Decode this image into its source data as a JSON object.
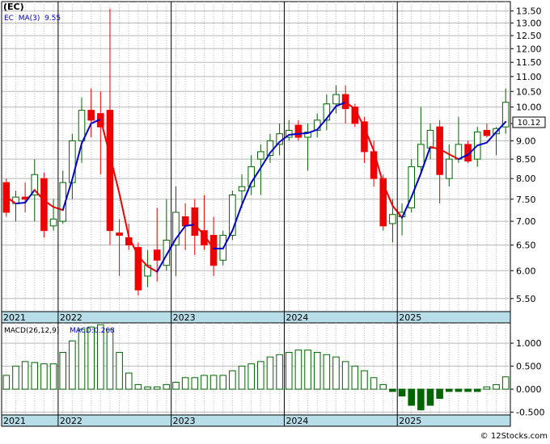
{
  "header": {
    "symbol": "(EC)",
    "ma_label": "EC  MA(3)  9.55",
    "macd_label": "MACD(26,12,9)",
    "macd_value_label": "MACD:0.268",
    "last_price_tag": "10.12",
    "watermark": "© 12Stocks.com"
  },
  "colors": {
    "up_candle": "#006400",
    "down_candle": "#ee0000",
    "ma_up": "#0000cc",
    "ma_down": "#ee0000",
    "macd_bar": "#006400",
    "axis_band": "#b7dde8",
    "grid": "#b8b8b8"
  },
  "chart_data": [
    {
      "type": "candlestick",
      "name": "price",
      "y_tick_labels": [
        "5.50",
        "6.00",
        "6.50",
        "7.00",
        "7.50",
        "8.00",
        "8.50",
        "9.00",
        "9.50",
        "10.00",
        "10.50",
        "11.00",
        "11.50",
        "12.00",
        "12.50",
        "13.00",
        "13.50"
      ],
      "y_scale": "log",
      "ylim": [
        5.28,
        13.9
      ],
      "x_labels": [
        {
          "label": "2021",
          "index": 0
        },
        {
          "label": "2022",
          "index": 6
        },
        {
          "label": "2023",
          "index": 18
        },
        {
          "label": "2024",
          "index": 30
        },
        {
          "label": "2025",
          "index": 42
        }
      ],
      "ohlc": [
        [
          7.9,
          8.0,
          7.1,
          7.2
        ],
        [
          7.4,
          7.7,
          7.0,
          7.55
        ],
        [
          7.55,
          7.9,
          7.2,
          7.5
        ],
        [
          7.6,
          8.5,
          7.0,
          8.1
        ],
        [
          8.0,
          8.15,
          6.65,
          6.8
        ],
        [
          6.9,
          7.5,
          6.8,
          7.05
        ],
        [
          7.0,
          8.2,
          6.95,
          7.9
        ],
        [
          7.9,
          9.2,
          7.5,
          9.0
        ],
        [
          9.0,
          10.3,
          8.4,
          9.9
        ],
        [
          9.9,
          10.6,
          9.1,
          9.6
        ],
        [
          9.8,
          10.5,
          8.1,
          9.4
        ],
        [
          9.9,
          13.6,
          6.5,
          6.8
        ],
        [
          6.75,
          7.05,
          5.9,
          6.7
        ],
        [
          6.65,
          6.95,
          6.4,
          6.5
        ],
        [
          6.45,
          6.55,
          5.55,
          5.65
        ],
        [
          5.9,
          6.4,
          5.7,
          6.1
        ],
        [
          6.4,
          7.3,
          5.8,
          6.2
        ],
        [
          6.1,
          7.5,
          6.0,
          6.6
        ],
        [
          6.5,
          7.8,
          5.9,
          7.2
        ],
        [
          7.1,
          7.4,
          6.4,
          6.9
        ],
        [
          7.3,
          7.5,
          6.3,
          6.7
        ],
        [
          6.8,
          7.6,
          6.4,
          6.5
        ],
        [
          6.7,
          7.1,
          5.9,
          6.1
        ],
        [
          6.2,
          6.8,
          6.1,
          6.7
        ],
        [
          6.7,
          7.7,
          6.6,
          7.6
        ],
        [
          7.7,
          8.1,
          7.3,
          7.8
        ],
        [
          7.8,
          8.6,
          7.6,
          8.3
        ],
        [
          8.5,
          8.9,
          7.6,
          8.7
        ],
        [
          8.6,
          9.2,
          8.4,
          9.0
        ],
        [
          8.9,
          9.5,
          8.6,
          9.2
        ],
        [
          9.1,
          9.6,
          9.0,
          9.3
        ],
        [
          9.45,
          9.6,
          9.0,
          9.1
        ],
        [
          9.1,
          9.5,
          8.2,
          9.25
        ],
        [
          9.3,
          9.8,
          9.1,
          9.6
        ],
        [
          9.6,
          10.4,
          9.3,
          10.1
        ],
        [
          10.1,
          10.7,
          9.8,
          10.4
        ],
        [
          10.4,
          10.7,
          9.5,
          9.95
        ],
        [
          10.0,
          10.1,
          9.4,
          9.5
        ],
        [
          9.55,
          9.7,
          8.4,
          8.7
        ],
        [
          8.7,
          9.0,
          7.8,
          8.0
        ],
        [
          8.0,
          8.1,
          6.8,
          6.9
        ],
        [
          6.95,
          7.5,
          6.55,
          7.15
        ],
        [
          7.1,
          7.4,
          6.7,
          7.2
        ],
        [
          7.3,
          8.5,
          7.2,
          8.3
        ],
        [
          8.3,
          10.0,
          8.1,
          8.9
        ],
        [
          8.8,
          9.5,
          8.5,
          9.3
        ],
        [
          9.4,
          9.6,
          7.4,
          8.1
        ],
        [
          8.0,
          8.9,
          7.8,
          8.5
        ],
        [
          8.5,
          9.7,
          8.4,
          8.9
        ],
        [
          8.9,
          9.0,
          8.4,
          8.45
        ],
        [
          8.5,
          9.4,
          8.3,
          9.25
        ],
        [
          9.3,
          9.5,
          9.1,
          9.15
        ],
        [
          9.2,
          9.4,
          8.6,
          9.35
        ],
        [
          9.4,
          10.6,
          9.2,
          10.15
        ]
      ],
      "ma3": [
        7.55,
        7.4,
        7.42,
        7.72,
        7.47,
        7.32,
        7.25,
        7.98,
        8.93,
        9.5,
        9.63,
        8.6,
        7.63,
        6.67,
        6.28,
        6.08,
        5.98,
        6.3,
        6.63,
        6.9,
        6.93,
        6.7,
        6.43,
        6.43,
        6.8,
        7.37,
        7.9,
        8.27,
        8.67,
        8.97,
        9.17,
        9.2,
        9.22,
        9.32,
        9.65,
        10.03,
        10.15,
        9.95,
        9.38,
        8.73,
        7.87,
        7.35,
        7.08,
        7.55,
        8.13,
        8.83,
        8.77,
        8.63,
        8.5,
        8.62,
        8.87,
        8.95,
        9.25,
        9.55
      ],
      "last_price": 10.12
    },
    {
      "type": "bar",
      "name": "MACD(26,12,9)",
      "y_tick_labels": [
        "-0.500",
        "0.000",
        "0.500",
        "1.000"
      ],
      "ylim": [
        -0.56,
        1.44
      ],
      "values": [
        0.3,
        0.5,
        0.6,
        0.58,
        0.55,
        0.55,
        0.8,
        1.05,
        1.3,
        1.35,
        1.4,
        1.3,
        0.8,
        0.35,
        0.1,
        0.05,
        0.05,
        0.1,
        0.15,
        0.25,
        0.25,
        0.3,
        0.3,
        0.3,
        0.4,
        0.5,
        0.55,
        0.6,
        0.7,
        0.75,
        0.8,
        0.85,
        0.85,
        0.8,
        0.75,
        0.7,
        0.6,
        0.5,
        0.4,
        0.25,
        0.1,
        -0.05,
        -0.15,
        -0.35,
        -0.45,
        -0.35,
        -0.2,
        -0.05,
        -0.05,
        -0.05,
        -0.05,
        0.05,
        0.1,
        0.268
      ]
    }
  ]
}
